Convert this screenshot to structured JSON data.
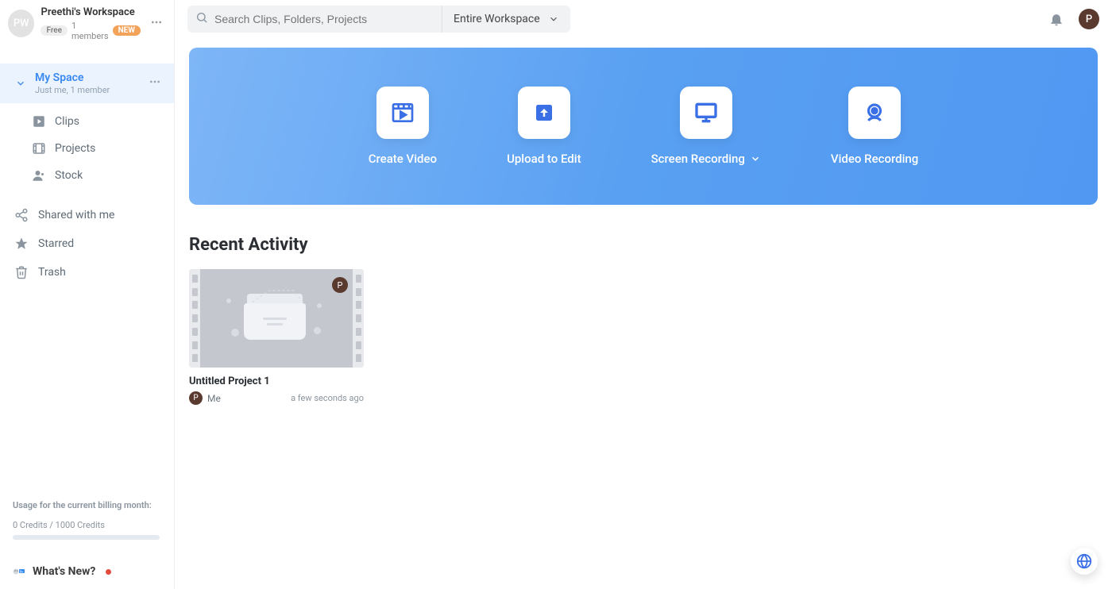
{
  "workspace": {
    "avatar_initials": "PW",
    "name": "Preethi's Workspace",
    "plan": "Free",
    "members": "1 members",
    "new_badge": "NEW"
  },
  "sidebar": {
    "space": {
      "name": "My Space",
      "sub": "Just me, 1 member"
    },
    "items": [
      {
        "id": "clips",
        "label": "Clips"
      },
      {
        "id": "projects",
        "label": "Projects"
      },
      {
        "id": "stock",
        "label": "Stock"
      }
    ],
    "sections": [
      {
        "id": "shared",
        "label": "Shared with me"
      },
      {
        "id": "starred",
        "label": "Starred"
      },
      {
        "id": "trash",
        "label": "Trash"
      }
    ],
    "usage": {
      "label": "Usage for the current billing month:",
      "text": "0 Credits / 1000 Credits",
      "percent": 0
    },
    "whats_new": "What's New?"
  },
  "topbar": {
    "search_placeholder": "Search Clips, Folders, Projects",
    "scope": "Entire Workspace",
    "user_initial": "P"
  },
  "hero": {
    "items": [
      {
        "id": "create",
        "label": "Create Video"
      },
      {
        "id": "upload",
        "label": "Upload to Edit"
      },
      {
        "id": "screen",
        "label": "Screen Recording",
        "has_chevron": true
      },
      {
        "id": "video",
        "label": "Video Recording"
      }
    ]
  },
  "recent": {
    "title": "Recent Activity",
    "projects": [
      {
        "name": "Untitled Project 1",
        "owner_initial": "P",
        "owner_label": "Me",
        "time": "a few seconds ago"
      }
    ]
  }
}
